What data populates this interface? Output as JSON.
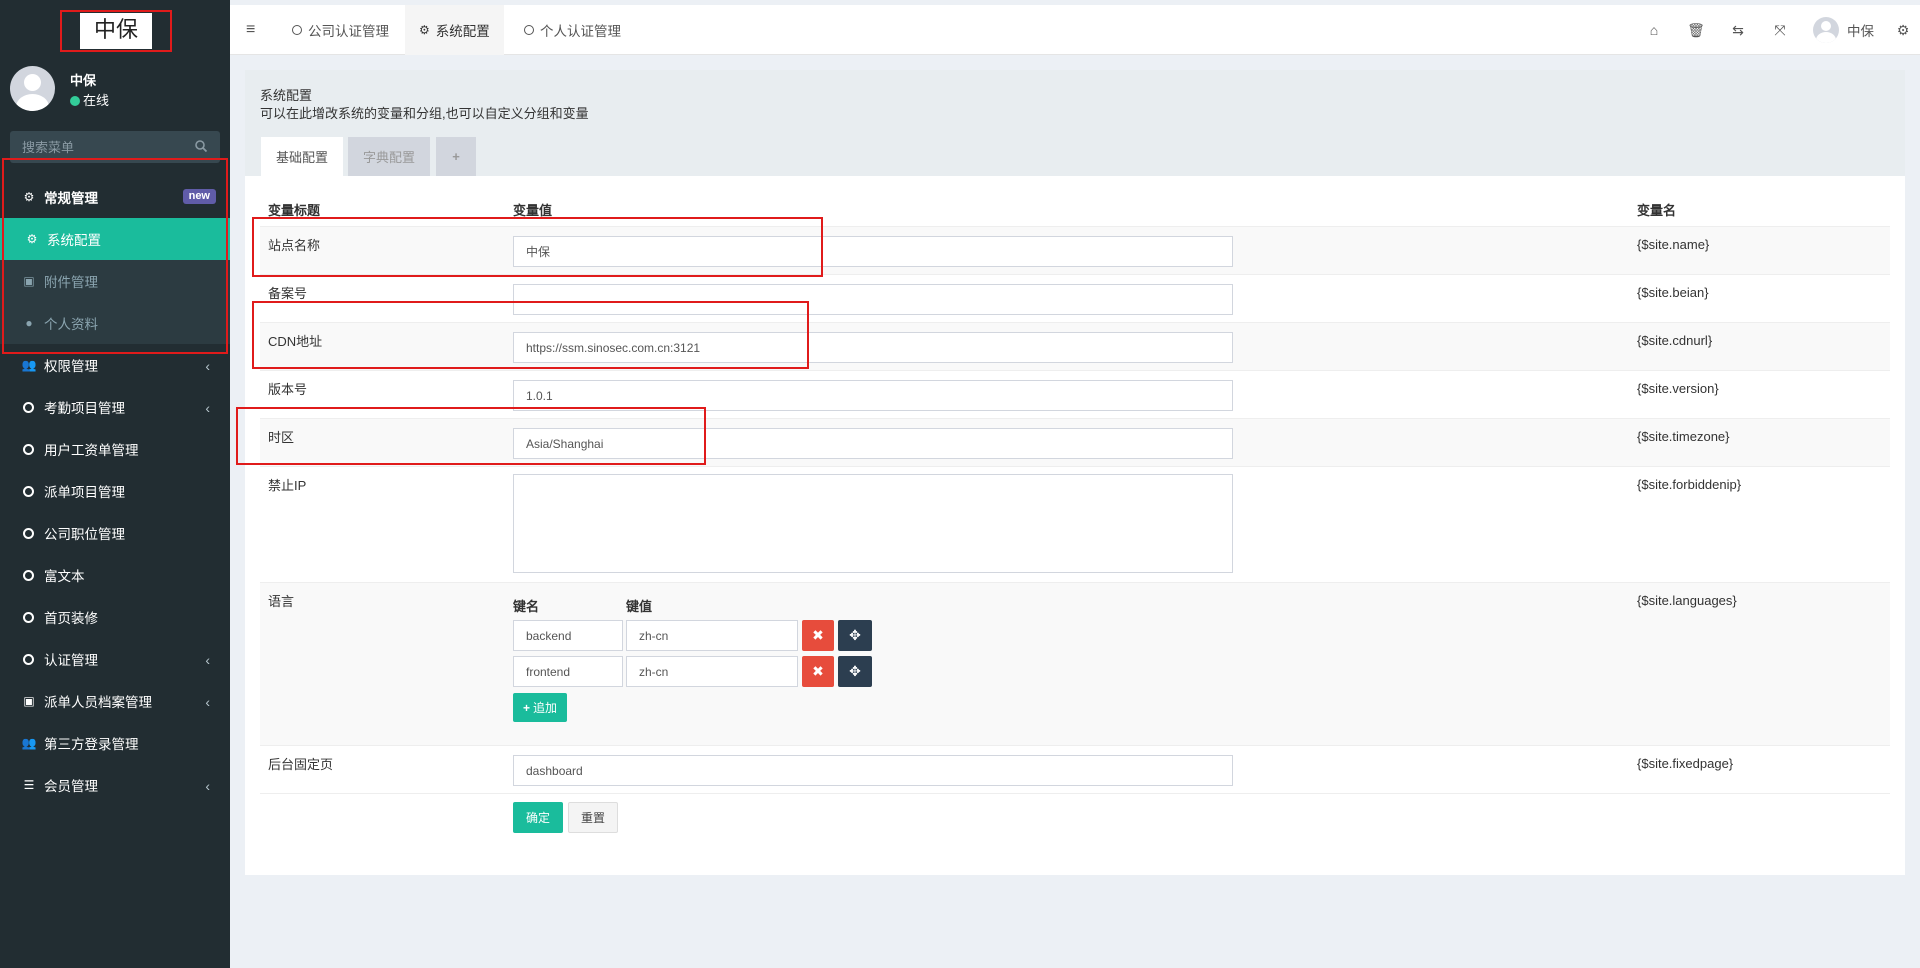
{
  "brand": {
    "logo_text": "中保"
  },
  "user": {
    "name": "中保",
    "status": "在线"
  },
  "search": {
    "placeholder": "搜索菜单"
  },
  "menu": {
    "general": {
      "label": "常规管理",
      "badge": "new"
    },
    "sub": [
      {
        "label": "系统配置",
        "icon": "gear-icon"
      },
      {
        "label": "附件管理",
        "icon": "image-icon"
      },
      {
        "label": "个人资料",
        "icon": "user-icon"
      }
    ],
    "items": [
      {
        "label": "权限管理",
        "icon": "users-icon",
        "chevron": "‹"
      },
      {
        "label": "考勤项目管理",
        "icon": "circle-icon",
        "chevron": "‹"
      },
      {
        "label": "用户工资单管理",
        "icon": "circle-icon",
        "chevron": ""
      },
      {
        "label": "派单项目管理",
        "icon": "circle-icon",
        "chevron": ""
      },
      {
        "label": "公司职位管理",
        "icon": "circle-icon",
        "chevron": ""
      },
      {
        "label": "富文本",
        "icon": "circle-icon",
        "chevron": ""
      },
      {
        "label": "首页装修",
        "icon": "circle-icon",
        "chevron": ""
      },
      {
        "label": "认证管理",
        "icon": "circle-icon",
        "chevron": "‹"
      },
      {
        "label": "派单人员档案管理",
        "icon": "id-card-icon",
        "chevron": "‹"
      },
      {
        "label": "第三方登录管理",
        "icon": "users-icon",
        "chevron": ""
      },
      {
        "label": "会员管理",
        "icon": "list-icon",
        "chevron": "‹"
      }
    ]
  },
  "topnav": {
    "tabs": [
      {
        "label": "公司认证管理"
      },
      {
        "label": "系统配置"
      },
      {
        "label": "个人认证管理"
      }
    ],
    "username": "中保"
  },
  "panel": {
    "title": "系统配置",
    "description": "可以在此增改系统的变量和分组,也可以自定义分组和变量",
    "tabs": [
      "基础配置",
      "字典配置",
      "+"
    ]
  },
  "table": {
    "headers": {
      "label": "变量标题",
      "value": "变量值",
      "name": "变量名"
    },
    "rows": [
      {
        "label": "站点名称",
        "value": "中保",
        "name": "{$site.name}"
      },
      {
        "label": "备案号",
        "value": "",
        "name": "{$site.beian}"
      },
      {
        "label": "CDN地址",
        "value": "https://ssm.sinosec.com.cn:3121",
        "name": "{$site.cdnurl}"
      },
      {
        "label": "版本号",
        "value": "1.0.1",
        "name": "{$site.version}"
      },
      {
        "label": "时区",
        "value": "Asia/Shanghai",
        "name": "{$site.timezone}"
      },
      {
        "label": "禁止IP",
        "value": "",
        "name": "{$site.forbiddenip}"
      },
      {
        "label": "语言",
        "name": "{$site.languages}"
      },
      {
        "label": "后台固定页",
        "value": "dashboard",
        "name": "{$site.fixedpage}"
      }
    ],
    "languages": {
      "key_header": "键名",
      "value_header": "键值",
      "pairs": [
        {
          "key": "backend",
          "value": "zh-cn"
        },
        {
          "key": "frontend",
          "value": "zh-cn"
        }
      ],
      "add_label": "追加"
    }
  },
  "actions": {
    "submit": "确定",
    "reset": "重置"
  },
  "colors": {
    "accent": "#1abc9c",
    "sidebar": "#222d32",
    "danger": "#e74c3c",
    "highlight_box": "#e01b1b"
  }
}
